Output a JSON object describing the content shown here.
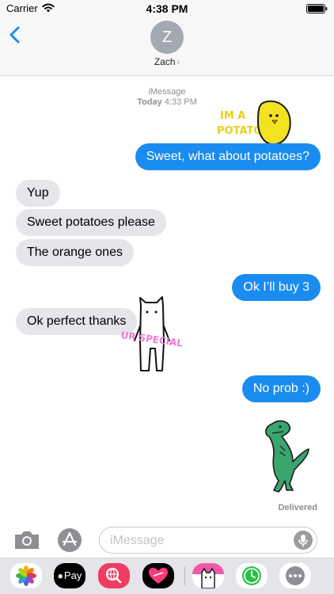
{
  "status_bar": {
    "carrier": "Carrier",
    "time": "4:38 PM"
  },
  "header": {
    "avatar_initial": "Z",
    "contact_name": "Zach",
    "chevron": "›"
  },
  "conversation": {
    "service": "iMessage",
    "day": "Today",
    "time": "4:33 PM",
    "messages": [
      {
        "direction": "outgoing",
        "text": "Sweet, what about potatoes?"
      },
      {
        "direction": "incoming",
        "text": "Yup"
      },
      {
        "direction": "incoming",
        "text": "Sweet potatoes please"
      },
      {
        "direction": "incoming",
        "text": "The orange ones"
      },
      {
        "direction": "outgoing",
        "text": "Ok I’ll buy 3"
      },
      {
        "direction": "incoming",
        "text": "Ok perfect thanks"
      },
      {
        "direction": "outgoing",
        "text": "No prob :)"
      }
    ],
    "stickers": {
      "potato": {
        "line1": "IM A",
        "line2": "POTATO"
      },
      "cat": {
        "caption": "UR SPECIAL"
      },
      "dino": {
        "icon": "dinosaur-sticker"
      }
    },
    "delivered_label": "Delivered"
  },
  "input_bar": {
    "placeholder": "iMessage",
    "value": ""
  },
  "app_drawer": {
    "pay_label": "Pay",
    "apps": [
      "photos-icon",
      "apple-pay-icon",
      "web-search-icon",
      "heart-sticker-icon",
      "cat-sticker-icon",
      "clock-icon",
      "more-icon"
    ]
  },
  "colors": {
    "accent": "#1a8cf0",
    "incoming_bubble": "#e5e5ea",
    "meta_text": "#8e8e93"
  }
}
